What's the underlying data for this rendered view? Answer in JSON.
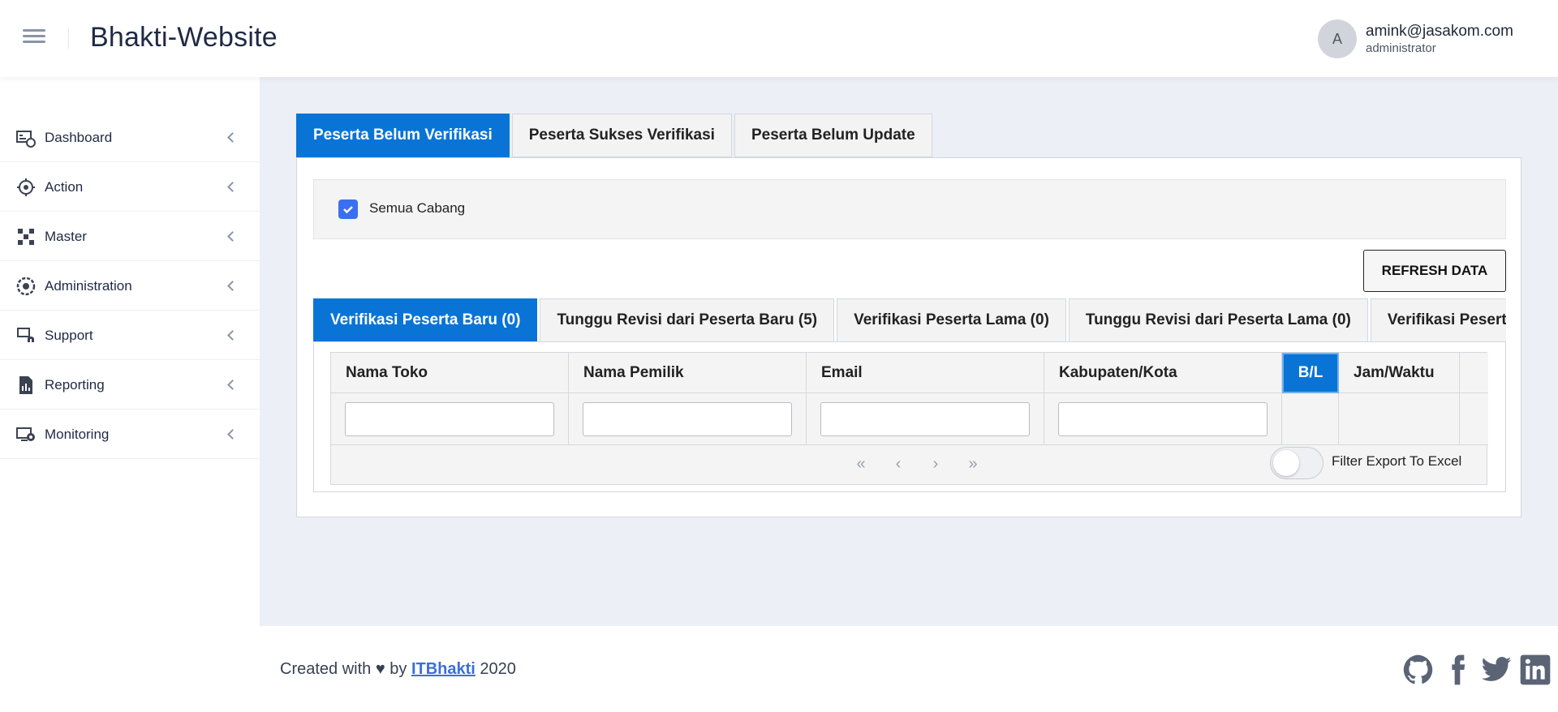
{
  "header": {
    "app_title": "Bhakti-Website",
    "user": {
      "avatar_initial": "A",
      "email": "amink@jasakom.com",
      "role": "administrator"
    }
  },
  "sidebar": {
    "items": [
      {
        "label": "Dashboard",
        "icon": "dashboard-icon"
      },
      {
        "label": "Action",
        "icon": "action-icon"
      },
      {
        "label": "Master",
        "icon": "master-icon"
      },
      {
        "label": "Administration",
        "icon": "administration-icon"
      },
      {
        "label": "Support",
        "icon": "support-icon"
      },
      {
        "label": "Reporting",
        "icon": "reporting-icon"
      },
      {
        "label": "Monitoring",
        "icon": "monitoring-icon"
      }
    ]
  },
  "main": {
    "tabs": [
      {
        "label": "Peserta Belum Verifikasi",
        "active": true
      },
      {
        "label": "Peserta Sukses Verifikasi",
        "active": false
      },
      {
        "label": "Peserta Belum Update",
        "active": false
      }
    ],
    "filter": {
      "checkbox_label": "Semua Cabang",
      "checked": true
    },
    "refresh_label": "REFRESH DATA",
    "inner_tabs": [
      {
        "label": "Verifikasi Peserta Baru (0)",
        "active": true
      },
      {
        "label": "Tunggu Revisi dari Peserta Baru (5)",
        "active": false
      },
      {
        "label": "Verifikasi Peserta Lama (0)",
        "active": false
      },
      {
        "label": "Tunggu Revisi dari Peserta Lama (0)",
        "active": false
      },
      {
        "label": "Verifikasi Peserta",
        "active": false
      }
    ],
    "grid": {
      "columns": [
        "Nama Toko",
        "Nama Pemilik",
        "Email",
        "Kabupaten/Kota",
        "B/L",
        "Jam/Waktu"
      ],
      "filter_values": [
        "",
        "",
        "",
        ""
      ],
      "pager": [
        "«",
        "‹",
        "›",
        "»"
      ],
      "export_label": "Filter Export To Excel",
      "export_enabled": false
    }
  },
  "footer": {
    "prefix": "Created with ♥ by ",
    "link_text": "ITBhakti",
    "suffix": " 2020",
    "socials": [
      "github-icon",
      "facebook-icon",
      "twitter-icon",
      "linkedin-icon"
    ]
  }
}
